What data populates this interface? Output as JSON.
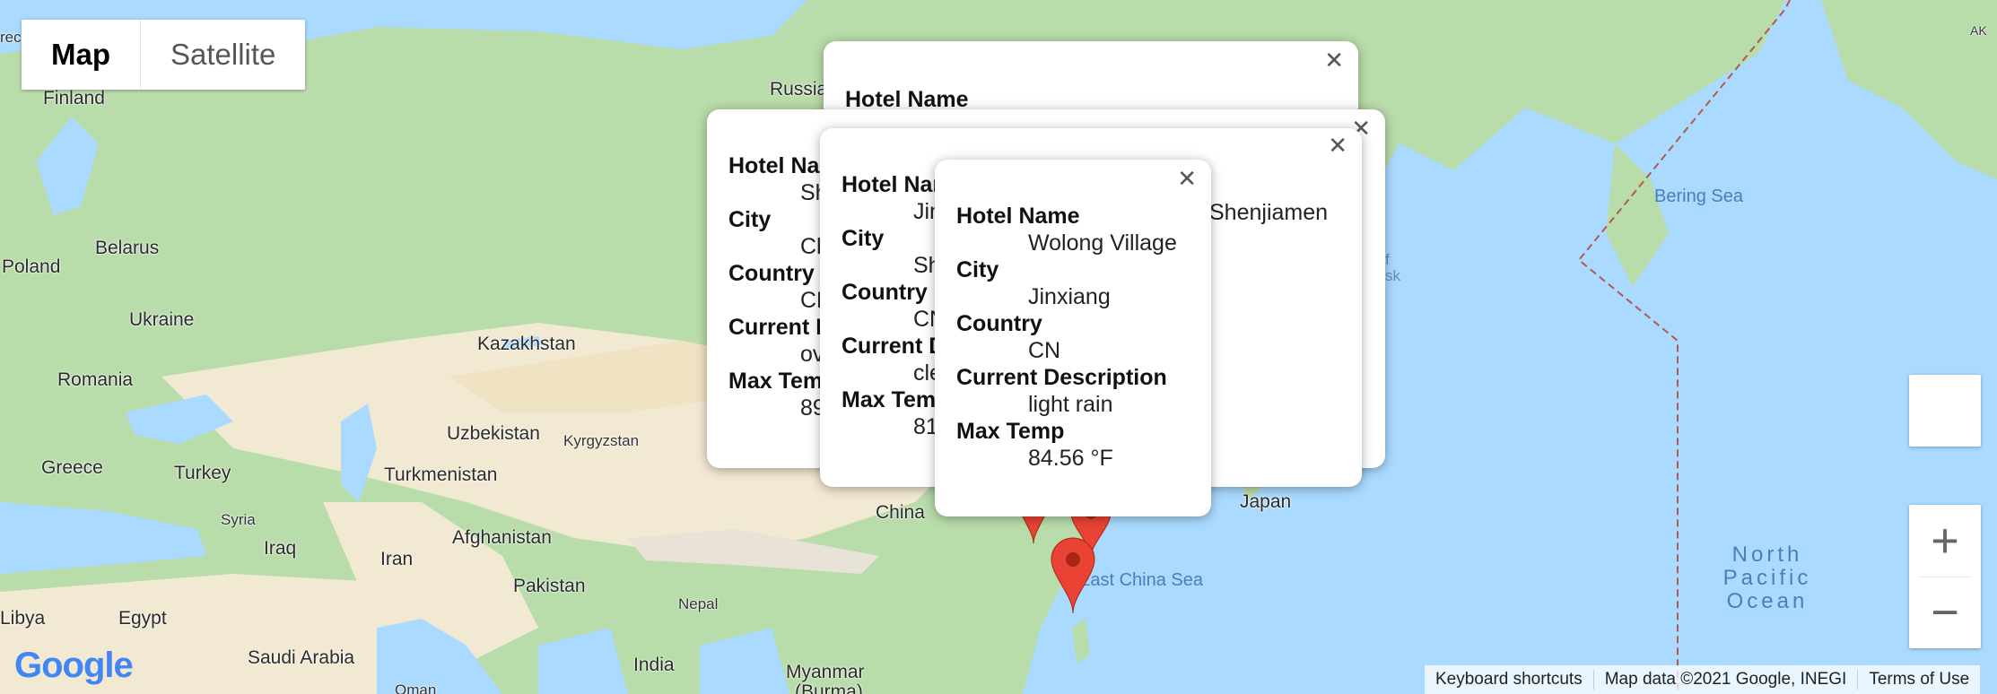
{
  "map_type": {
    "map": "Map",
    "satellite": "Satellite"
  },
  "labels": {
    "finland": "Finland",
    "russia": "Russia",
    "belarus": "Belarus",
    "poland": "Poland",
    "ukraine": "Ukraine",
    "romania": "Romania",
    "kazakhstan": "Kazakhstan",
    "uzbekistan": "Uzbekistan",
    "kyrgyzstan": "Kyrgyzstan",
    "turkmenistan": "Turkmenistan",
    "greece": "Greece",
    "turkey": "Turkey",
    "syria": "Syria",
    "iraq": "Iraq",
    "iran": "Iran",
    "afghanistan": "Afghanistan",
    "pakistan": "Pakistan",
    "nepal": "Nepal",
    "india": "India",
    "myanmar": "Myanmar",
    "burma": "(Burma)",
    "china": "China",
    "japan": "Japan",
    "libya": "Libya",
    "egypt": "Egypt",
    "saudi": "Saudi Arabia",
    "oman": "Oman",
    "bering": "Bering Sea",
    "ecs": "East China Sea",
    "ocean": "North Pacific Ocean",
    "ak": "AK",
    "okhotsk_f": "f",
    "okhotsk_sk": "sk",
    "rec": "rec"
  },
  "popups": [
    {
      "heading": "Hotel Name",
      "visible_value": "Shenjiamen"
    },
    {
      "items": [
        "Hotel Na",
        "Sh",
        "City",
        "Ch",
        "Country",
        "CN",
        "Current D",
        "ov",
        "Max Tem",
        "89"
      ]
    },
    {
      "items": [
        "Hotel Nar",
        "Jin",
        "City",
        "Sh",
        "Country",
        "CN",
        "Current D",
        "cle",
        "Max Tem",
        "81"
      ]
    },
    {
      "hotel_label": "Hotel Name",
      "hotel_value": "Wolong Village",
      "city_label": "City",
      "city_value": "Jinxiang",
      "country_label": "Country",
      "country_value": "CN",
      "desc_label": "Current Description",
      "desc_value": "light rain",
      "temp_label": "Max Temp",
      "temp_value": "84.56 °F"
    }
  ],
  "attribution": {
    "shortcuts": "Keyboard shortcuts",
    "data": "Map data ©2021 Google, INEGI",
    "terms": "Terms of Use"
  },
  "logo": "Google",
  "zoom": {
    "in": "+",
    "out": "−"
  },
  "colors": {
    "water": "#aadaff",
    "land_green": "#b9dcab",
    "land_desert": "#f2e9d3",
    "marker": "#ea4335",
    "marker_dark": "#a52714"
  }
}
